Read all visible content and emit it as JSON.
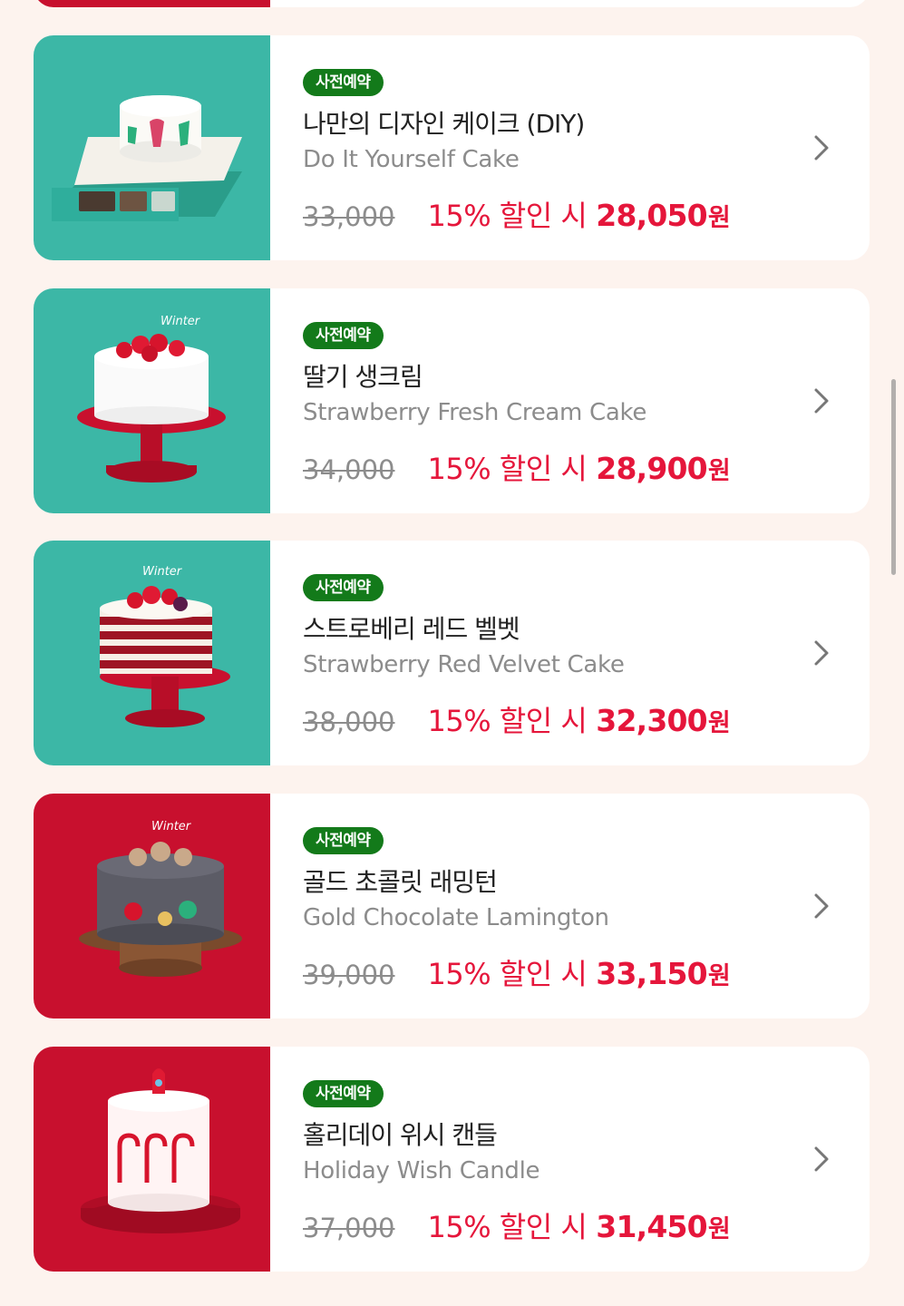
{
  "products": [
    {
      "badge": "사전예약",
      "name_ko": "나만의 디자인 케이크 (DIY)",
      "name_en": "Do It Yourself Cake",
      "original_price": "33,000",
      "discount_label": "15% 할인 시",
      "final_price": "28,050",
      "currency": "원",
      "image_icon": "diy-cake-kit-image",
      "image_bg": "#3cb7a6"
    },
    {
      "badge": "사전예약",
      "name_ko": "딸기 생크림",
      "name_en": "Strawberry Fresh Cream Cake",
      "original_price": "34,000",
      "discount_label": "15% 할인 시",
      "final_price": "28,900",
      "currency": "원",
      "image_icon": "strawberry-cream-cake-image",
      "image_bg": "#3cb7a6"
    },
    {
      "badge": "사전예약",
      "name_ko": "스트로베리 레드 벨벳",
      "name_en": "Strawberry Red Velvet Cake",
      "original_price": "38,000",
      "discount_label": "15% 할인 시",
      "final_price": "32,300",
      "currency": "원",
      "image_icon": "red-velvet-cake-image",
      "image_bg": "#3cb7a6"
    },
    {
      "badge": "사전예약",
      "name_ko": "골드 초콜릿 래밍턴",
      "name_en": "Gold Chocolate Lamington",
      "original_price": "39,000",
      "discount_label": "15% 할인 시",
      "final_price": "33,150",
      "currency": "원",
      "image_icon": "lamington-cake-image",
      "image_bg": "#c8102e"
    },
    {
      "badge": "사전예약",
      "name_ko": "홀리데이 위시 캔들",
      "name_en": "Holiday Wish Candle",
      "original_price": "37,000",
      "discount_label": "15% 할인 시",
      "final_price": "31,450",
      "currency": "원",
      "image_icon": "wish-candle-cake-image",
      "image_bg": "#c8102e"
    }
  ],
  "colors": {
    "accent_red": "#e5163b",
    "badge_green": "#137a1a",
    "page_bg": "#fdf3ee",
    "muted_text": "#8c8c8c"
  }
}
